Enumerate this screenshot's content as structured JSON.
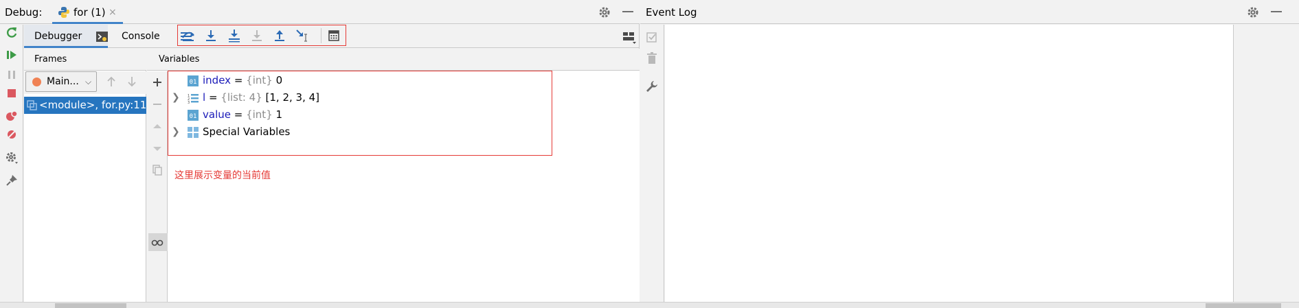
{
  "debug": {
    "title": "Debug:",
    "session_tab": "for (1)",
    "close_glyph": "×",
    "tabs": {
      "debugger": "Debugger",
      "console": "Console"
    }
  },
  "frames": {
    "header": "Frames",
    "thread": "Main...",
    "thread_color": "#f08254",
    "frame_row": "<module>, for.py:11"
  },
  "variables": {
    "header": "Variables",
    "rows": [
      {
        "name": "index",
        "eq": " = ",
        "type": "{int}",
        "value": " 0"
      },
      {
        "name": "l",
        "eq": " = ",
        "type": "{list: 4}",
        "value": " [1, 2, 3, 4]"
      },
      {
        "name": "value",
        "eq": " = ",
        "type": "{int}",
        "value": " 1"
      },
      {
        "label": "Special Variables"
      }
    ],
    "note": "这里展示变量的当前值"
  },
  "event_log": {
    "title": "Event Log"
  },
  "colors": {
    "accent": "#4083c9",
    "selection": "#2675bf",
    "highlight_box": "#e53935",
    "var_name": "#1a1ab8",
    "green": "#3d9b47",
    "red": "#db5860"
  },
  "icons": {
    "left_toolbar": [
      "rerun-icon",
      "resume-icon",
      "pause-icon",
      "stop-icon",
      "view-breakpoints-icon",
      "mute-breakpoints-icon",
      "settings-icon",
      "pin-icon"
    ],
    "step_toolbar": [
      "show-execution-point-icon",
      "step-over-icon",
      "step-into-icon",
      "step-into-my-code-icon",
      "force-step-into-icon",
      "step-out-icon",
      "run-to-cursor-icon",
      "evaluate-expression-icon"
    ]
  }
}
